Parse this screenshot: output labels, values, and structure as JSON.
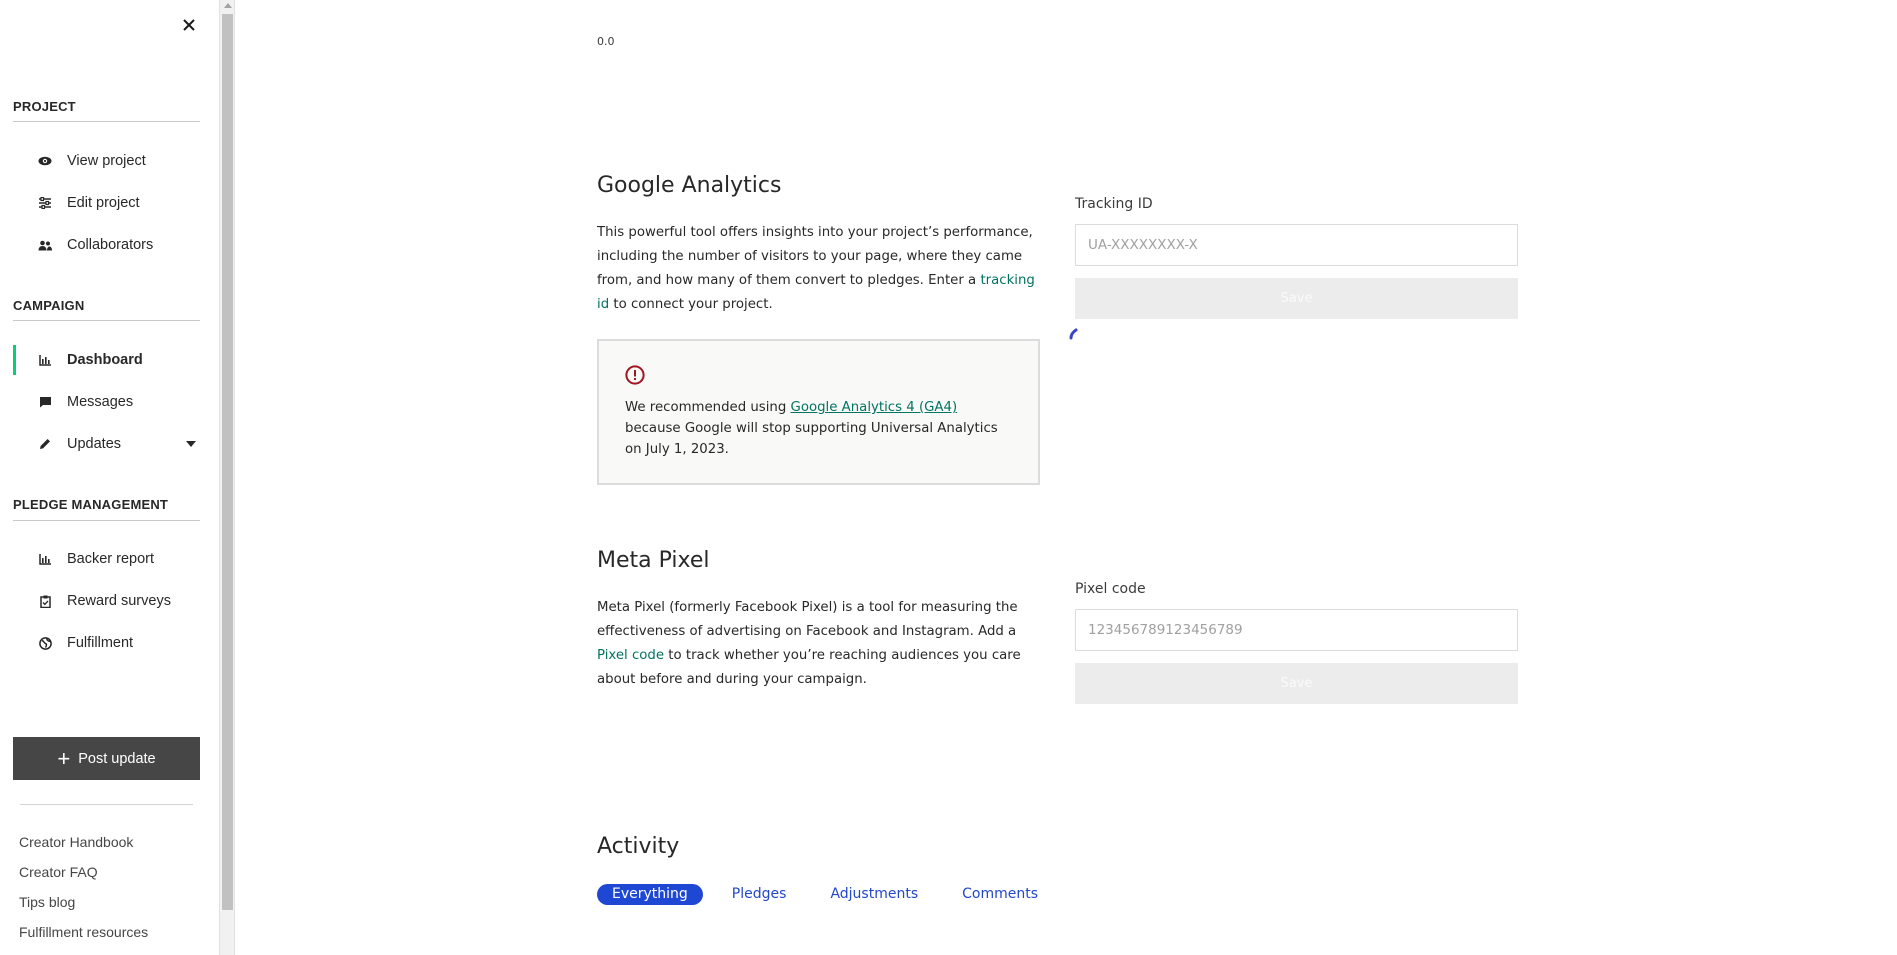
{
  "sidebar": {
    "sections": {
      "project": "PROJECT",
      "campaign": "CAMPAIGN",
      "pledge": "PLEDGE MANAGEMENT"
    },
    "items": {
      "view_project": "View project",
      "edit_project": "Edit project",
      "collaborators": "Collaborators",
      "dashboard": "Dashboard",
      "messages": "Messages",
      "updates": "Updates",
      "backer_report": "Backer report",
      "reward_surveys": "Reward surveys",
      "fulfillment": "Fulfillment"
    },
    "post_update": "Post update",
    "footer_links": {
      "handbook": "Creator Handbook",
      "faq": "Creator FAQ",
      "tips": "Tips blog",
      "fulfillment_resources": "Fulfillment resources"
    },
    "accent": "#05ce78"
  },
  "main": {
    "top_value": "0.0",
    "google": {
      "title": "Google Analytics",
      "desc_before": "This powerful tool offers insights into your project’s performance, including the number of visitors to your page, where they came from, and how many of them convert to pledges. Enter a ",
      "desc_link": "tracking id",
      "desc_after": " to connect your project.",
      "field_label": "Tracking ID",
      "placeholder": "UA-XXXXXXXX-X",
      "save": "Save",
      "warning_before": "We recommended using ",
      "warning_link": "Google Analytics 4 (GA4)",
      "warning_after": " because Google will stop supporting Universal Analytics on July 1, 2023."
    },
    "meta": {
      "title": "Meta Pixel",
      "desc_before": "Meta Pixel (formerly Facebook Pixel) is a tool for measuring the effectiveness of advertising on Facebook and Instagram. Add a ",
      "desc_link": "Pixel code",
      "desc_after": " to track whether you’re reaching audiences you care about before and during your campaign.",
      "field_label": "Pixel code",
      "placeholder": "123456789123456789",
      "save": "Save"
    },
    "activity": {
      "title": "Activity",
      "tabs": {
        "everything": "Everything",
        "pledges": "Pledges",
        "adjustments": "Adjustments",
        "comments": "Comments"
      }
    }
  }
}
